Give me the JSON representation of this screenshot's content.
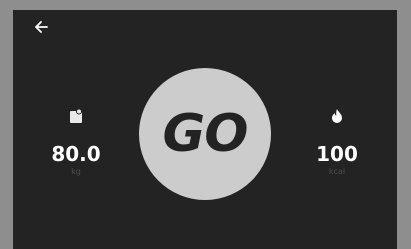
{
  "colors": {
    "frame": "#8e8e8e",
    "screen_background": "#232323",
    "go_button": "#cccccc",
    "value_text": "#ffffff",
    "unit_text": "#4d4d4d"
  },
  "header": {
    "back_icon": "arrow-left-icon"
  },
  "weight": {
    "icon": "clipboard-icon",
    "value": "80.0",
    "unit": "kg"
  },
  "go_button": {
    "label": "GO"
  },
  "calories": {
    "icon": "flame-icon",
    "value": "100",
    "unit": "kcal"
  }
}
